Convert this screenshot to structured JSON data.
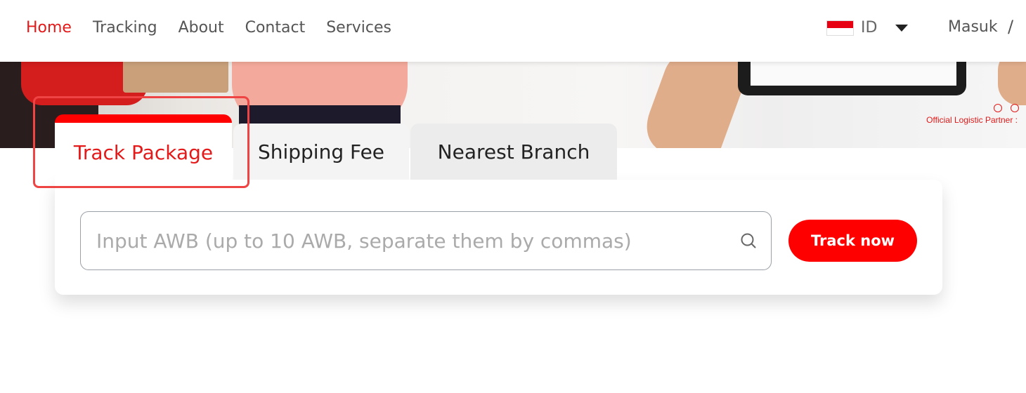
{
  "nav": {
    "links": [
      "Home",
      "Tracking",
      "About",
      "Contact",
      "Services"
    ],
    "active": "Home",
    "lang_code": "ID",
    "login": "Masuk",
    "separator": "/"
  },
  "hero": {
    "partner_text": "Official Logistic Partner :"
  },
  "tabs": [
    {
      "label": "Track Package",
      "active": true
    },
    {
      "label": "Shipping Fee",
      "active": false
    },
    {
      "label": "Nearest Branch",
      "active": false
    }
  ],
  "search": {
    "placeholder": "Input AWB (up to 10 AWB, separate them by commas)",
    "value": "",
    "button_label": "Track now"
  },
  "colors": {
    "accent": "#ff0000",
    "active_text": "#e41a1a",
    "highlight_outline": "#ef4444"
  },
  "icons": {
    "flag": "indonesia-flag-icon",
    "dropdown": "chevron-down-icon",
    "search": "search-icon"
  }
}
